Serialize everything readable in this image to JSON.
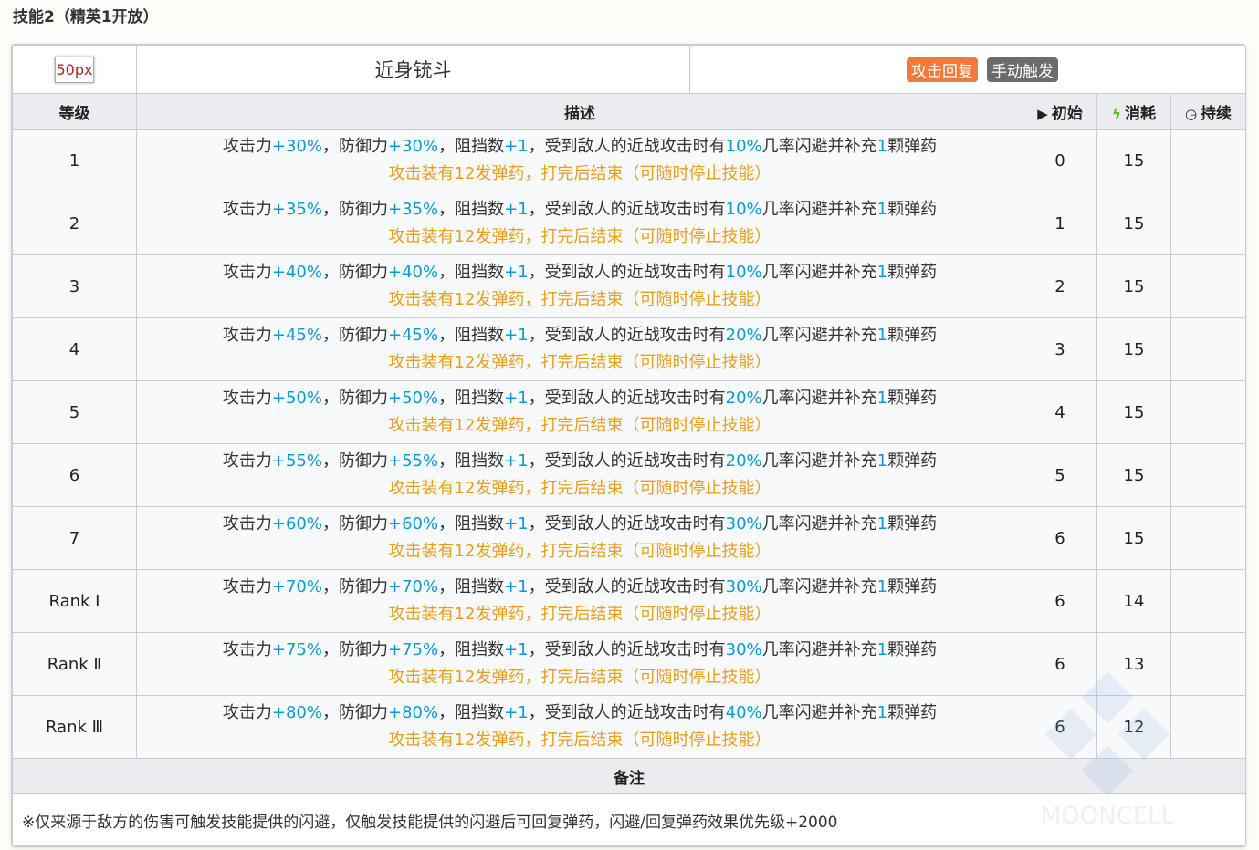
{
  "section_title": "技能2（精英1开放）",
  "skill": {
    "icon_label": "50px",
    "name": "近身铳斗",
    "tags": [
      {
        "label": "攻击回复",
        "color": "#f0793c"
      },
      {
        "label": "手动触发",
        "color": "#6c6c6c"
      }
    ]
  },
  "headers": {
    "level": "等级",
    "description": "描述",
    "initial": "初始",
    "cost": "消耗",
    "duration": "持续"
  },
  "desc_parts": {
    "atk_prefix": "攻击力",
    "def_prefix": "，防御力",
    "block_prefix": "，阻挡数",
    "block_value": "+1",
    "melee_prefix": "，受到敌人的近战攻击时有",
    "dodge_suffix": "几率闪避并补充",
    "ammo_count": "1",
    "ammo_suffix": "颗弹药",
    "second_line": "攻击装有12发弹药，打完后结束（可随时停止技能）"
  },
  "levels": [
    {
      "level": "1",
      "atk": "+30%",
      "def": "+30%",
      "chance": "10%",
      "initial": "0",
      "cost": "15",
      "duration": ""
    },
    {
      "level": "2",
      "atk": "+35%",
      "def": "+35%",
      "chance": "10%",
      "initial": "1",
      "cost": "15",
      "duration": ""
    },
    {
      "level": "3",
      "atk": "+40%",
      "def": "+40%",
      "chance": "10%",
      "initial": "2",
      "cost": "15",
      "duration": ""
    },
    {
      "level": "4",
      "atk": "+45%",
      "def": "+45%",
      "chance": "20%",
      "initial": "3",
      "cost": "15",
      "duration": ""
    },
    {
      "level": "5",
      "atk": "+50%",
      "def": "+50%",
      "chance": "20%",
      "initial": "4",
      "cost": "15",
      "duration": ""
    },
    {
      "level": "6",
      "atk": "+55%",
      "def": "+55%",
      "chance": "20%",
      "initial": "5",
      "cost": "15",
      "duration": ""
    },
    {
      "level": "7",
      "atk": "+60%",
      "def": "+60%",
      "chance": "30%",
      "initial": "6",
      "cost": "15",
      "duration": ""
    },
    {
      "level": "Rank Ⅰ",
      "atk": "+70%",
      "def": "+70%",
      "chance": "30%",
      "initial": "6",
      "cost": "14",
      "duration": ""
    },
    {
      "level": "Rank Ⅱ",
      "atk": "+75%",
      "def": "+75%",
      "chance": "30%",
      "initial": "6",
      "cost": "13",
      "duration": ""
    },
    {
      "level": "Rank Ⅲ",
      "atk": "+80%",
      "def": "+80%",
      "chance": "40%",
      "initial": "6",
      "cost": "12",
      "duration": ""
    }
  ],
  "notes": {
    "header": "备注",
    "text": "※仅来源于敌方的伤害可触发技能提供的闪避，仅触发技能提供的闪避后可回复弹药，闪避/回复弹药效果优先级+2000"
  },
  "watermark": "MOONCELL"
}
